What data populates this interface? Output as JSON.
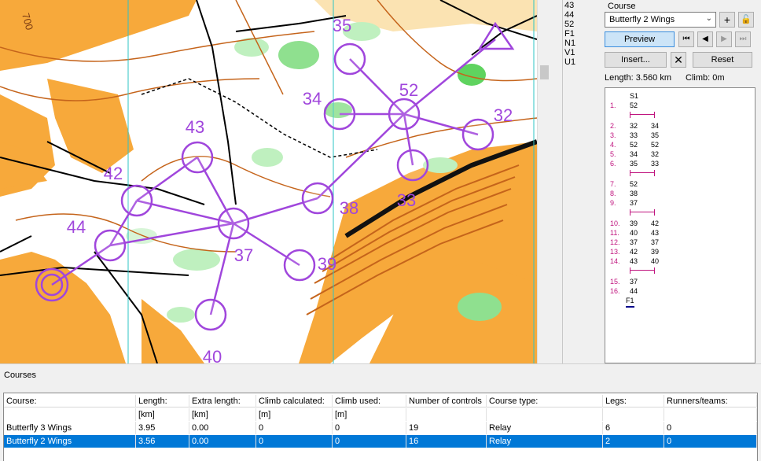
{
  "map": {
    "controls": [
      {
        "code": "35"
      },
      {
        "code": "52"
      },
      {
        "code": "34"
      },
      {
        "code": "32"
      },
      {
        "code": "43"
      },
      {
        "code": "42"
      },
      {
        "code": "33"
      },
      {
        "code": "38"
      },
      {
        "code": "44"
      },
      {
        "code": "37"
      },
      {
        "code": "39"
      },
      {
        "code": "40"
      }
    ],
    "scale_label": "700"
  },
  "code_list": [
    "43",
    "44",
    "52",
    "F1",
    "N1",
    "V1",
    "U1"
  ],
  "course_panel": {
    "title": "Course",
    "selected_course": "Butterfly 2 Wings",
    "add_icon": "plus-icon",
    "lock_icon": "lock-icon",
    "preview_label": "Preview",
    "first_icon": "skip-first-icon",
    "prev_icon": "prev-icon",
    "next_icon": "next-icon",
    "last_icon": "skip-last-icon",
    "insert_label": "Insert...",
    "delete_icon": "x-icon",
    "reset_label": "Reset",
    "length_text": "Length: 3.560 km",
    "climb_text": "Climb: 0m",
    "start": "S1",
    "finish": "F1",
    "legs": [
      {
        "n": "1.",
        "a": "52",
        "b": ""
      },
      {
        "n": "2.",
        "a": "32",
        "b": "34"
      },
      {
        "n": "3.",
        "a": "33",
        "b": "35"
      },
      {
        "n": "4.",
        "a": "52",
        "b": "52"
      },
      {
        "n": "5.",
        "a": "34",
        "b": "32"
      },
      {
        "n": "6.",
        "a": "35",
        "b": "33"
      },
      {
        "n": "7.",
        "a": "52",
        "b": ""
      },
      {
        "n": "8.",
        "a": "38",
        "b": ""
      },
      {
        "n": "9.",
        "a": "37",
        "b": ""
      },
      {
        "n": "10.",
        "a": "39",
        "b": "42"
      },
      {
        "n": "11.",
        "a": "40",
        "b": "43"
      },
      {
        "n": "12.",
        "a": "37",
        "b": "37"
      },
      {
        "n": "13.",
        "a": "42",
        "b": "39"
      },
      {
        "n": "14.",
        "a": "43",
        "b": "40"
      },
      {
        "n": "15.",
        "a": "37",
        "b": ""
      },
      {
        "n": "16.",
        "a": "44",
        "b": ""
      }
    ]
  },
  "courses_table": {
    "heading": "Courses",
    "headers": [
      "Course:",
      "Length:",
      "Extra length:",
      "Climb calculated:",
      "Climb used:",
      "Number of controls",
      "Course type:",
      "Legs:",
      "Runners/teams:"
    ],
    "units": [
      "",
      "[km]",
      "[km]",
      "[m]",
      "[m]",
      "",
      "",
      "",
      ""
    ],
    "rows": [
      [
        "Butterfly 3 Wings",
        "3.95",
        "0.00",
        "0",
        "0",
        "19",
        "Relay",
        "6",
        "0"
      ],
      [
        "Butterfly 2 Wings",
        "3.56",
        "0.00",
        "0",
        "0",
        "16",
        "Relay",
        "2",
        "0"
      ]
    ],
    "selected_row": 1
  }
}
